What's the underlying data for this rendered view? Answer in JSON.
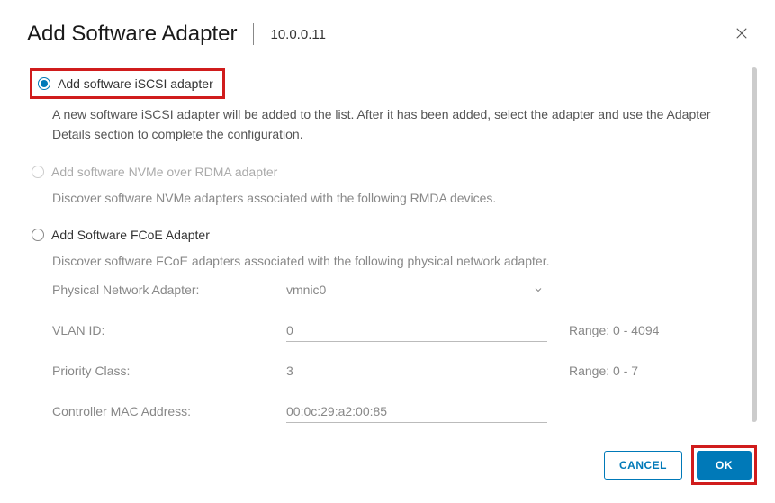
{
  "header": {
    "title": "Add Software Adapter",
    "ip": "10.0.0.11"
  },
  "options": {
    "iscsi": {
      "label": "Add software iSCSI adapter",
      "desc": "A new software iSCSI adapter will be added to the list. After it has been added, select the adapter and use the Adapter Details section to complete the configuration."
    },
    "nvme": {
      "label": "Add software NVMe over RDMA adapter",
      "desc": "Discover software NVMe adapters associated with the following RMDA devices."
    },
    "fcoe": {
      "label": "Add Software FCoE Adapter",
      "desc": "Discover software FCoE adapters associated with the following physical network adapter."
    }
  },
  "form": {
    "physical_adapter": {
      "label": "Physical Network Adapter:",
      "value": "vmnic0"
    },
    "vlan_id": {
      "label": "VLAN ID:",
      "value": "0",
      "range": "Range: 0 - 4094"
    },
    "priority": {
      "label": "Priority Class:",
      "value": "3",
      "range": "Range: 0 - 7"
    },
    "mac": {
      "label": "Controller MAC Address:",
      "value": "00:0c:29:a2:00:85"
    }
  },
  "footer": {
    "cancel": "CANCEL",
    "ok": "OK"
  }
}
